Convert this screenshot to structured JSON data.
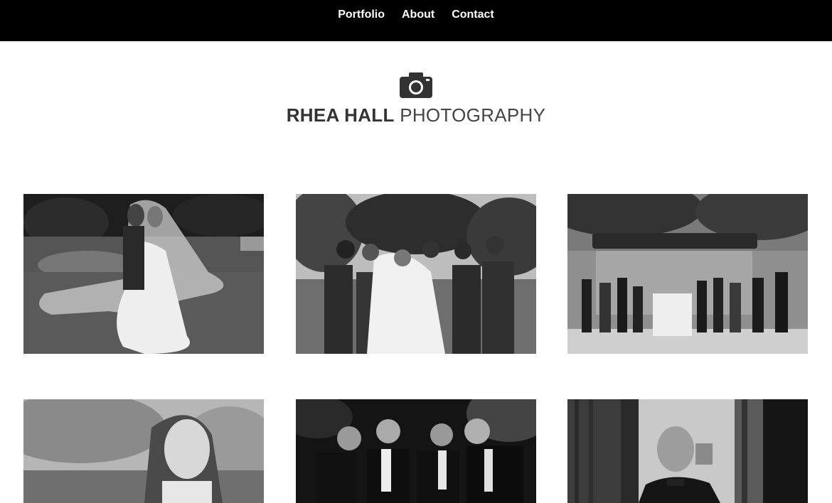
{
  "nav": {
    "portfolio": "Portfolio",
    "about": "About",
    "contact": "Contact"
  },
  "logo": {
    "icon": "camera-icon",
    "title_bold": "RHEA HALL",
    "title_light": "PHOTOGRAPHY"
  },
  "gallery": {
    "items": [
      {
        "subject": "bride and groom with flowing veil in garden"
      },
      {
        "subject": "bride laughing with bridesmaids"
      },
      {
        "subject": "wedding party at bus shelter"
      },
      {
        "subject": "bride portrait among trees"
      },
      {
        "subject": "groomsmen laughing at night"
      },
      {
        "subject": "groom smiling by window"
      }
    ]
  },
  "colors": {
    "nav_bg": "#000000",
    "nav_text": "#ffffff",
    "title_text": "#333333",
    "page_bg": "#ffffff"
  }
}
